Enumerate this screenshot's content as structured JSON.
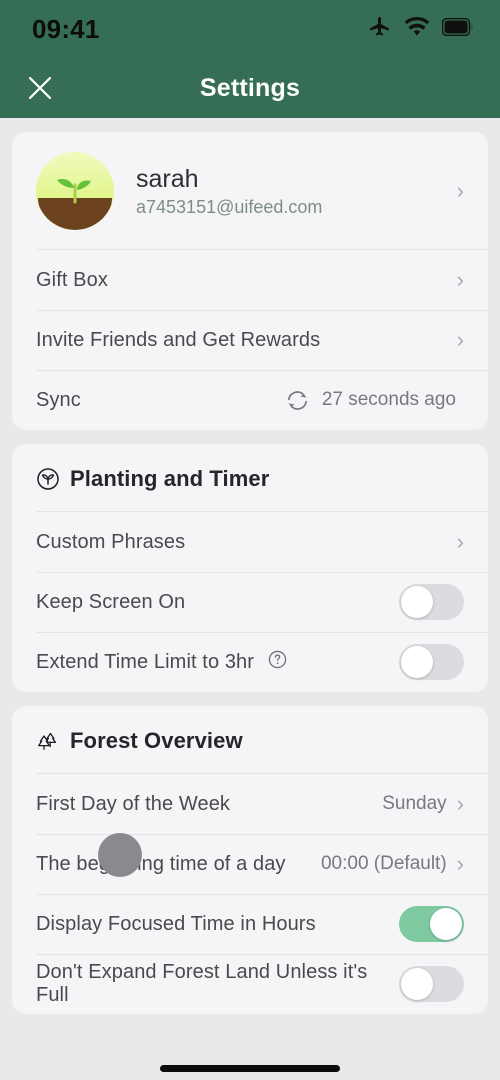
{
  "status_bar": {
    "time": "09:41",
    "icons": [
      "airplane-mode-icon",
      "wifi-icon",
      "battery-icon"
    ]
  },
  "nav": {
    "close_icon": "close-icon",
    "title": "Settings"
  },
  "colors": {
    "header_green": "#356e54",
    "toggle_on_green": "#7fc9a1",
    "toggle_off_gray": "#dcdce0",
    "page_background": "#e9e9eb",
    "card_background": "#f5f5f7",
    "label_text": "#4a4a4e",
    "value_text": "#787880",
    "email_text": "#7d8e86",
    "cursor_puck": "#8a8a8e"
  },
  "account_card": {
    "profile": {
      "name": "sarah",
      "email": "a7453151@uifeed.com",
      "avatar_icon": "sprout-avatar",
      "chevron": "›"
    },
    "rows": [
      {
        "label": "Gift Box",
        "type": "link",
        "chevron": "›"
      },
      {
        "label": "Invite Friends and Get Rewards",
        "type": "link",
        "chevron": "›"
      },
      {
        "label": "Sync",
        "type": "value",
        "value": "27 seconds ago",
        "icon": "sync-refresh-icon"
      }
    ]
  },
  "planting_section": {
    "icon": "sprout-circle-icon",
    "title": "Planting and Timer",
    "rows": [
      {
        "label": "Custom Phrases",
        "type": "link",
        "chevron": "›"
      },
      {
        "label": "Keep Screen On",
        "type": "toggle",
        "state": "off"
      },
      {
        "label": "Extend Time Limit to 3hr",
        "type": "toggle",
        "state": "off",
        "help_icon": "question-mark-icon"
      }
    ]
  },
  "forest_section": {
    "icon": "pine-trees-icon",
    "title": "Forest Overview",
    "rows": [
      {
        "label": "First Day of the Week",
        "type": "value",
        "value": "Sunday",
        "chevron": "›"
      },
      {
        "label": "The beginning time of a day",
        "type": "value",
        "value": "00:00 (Default)",
        "chevron": "›"
      },
      {
        "label": "Display Focused Time in Hours",
        "type": "toggle",
        "state": "on"
      },
      {
        "label": "Don't Expand Forest Land Unless it's Full",
        "type": "toggle",
        "state": "off"
      }
    ]
  }
}
